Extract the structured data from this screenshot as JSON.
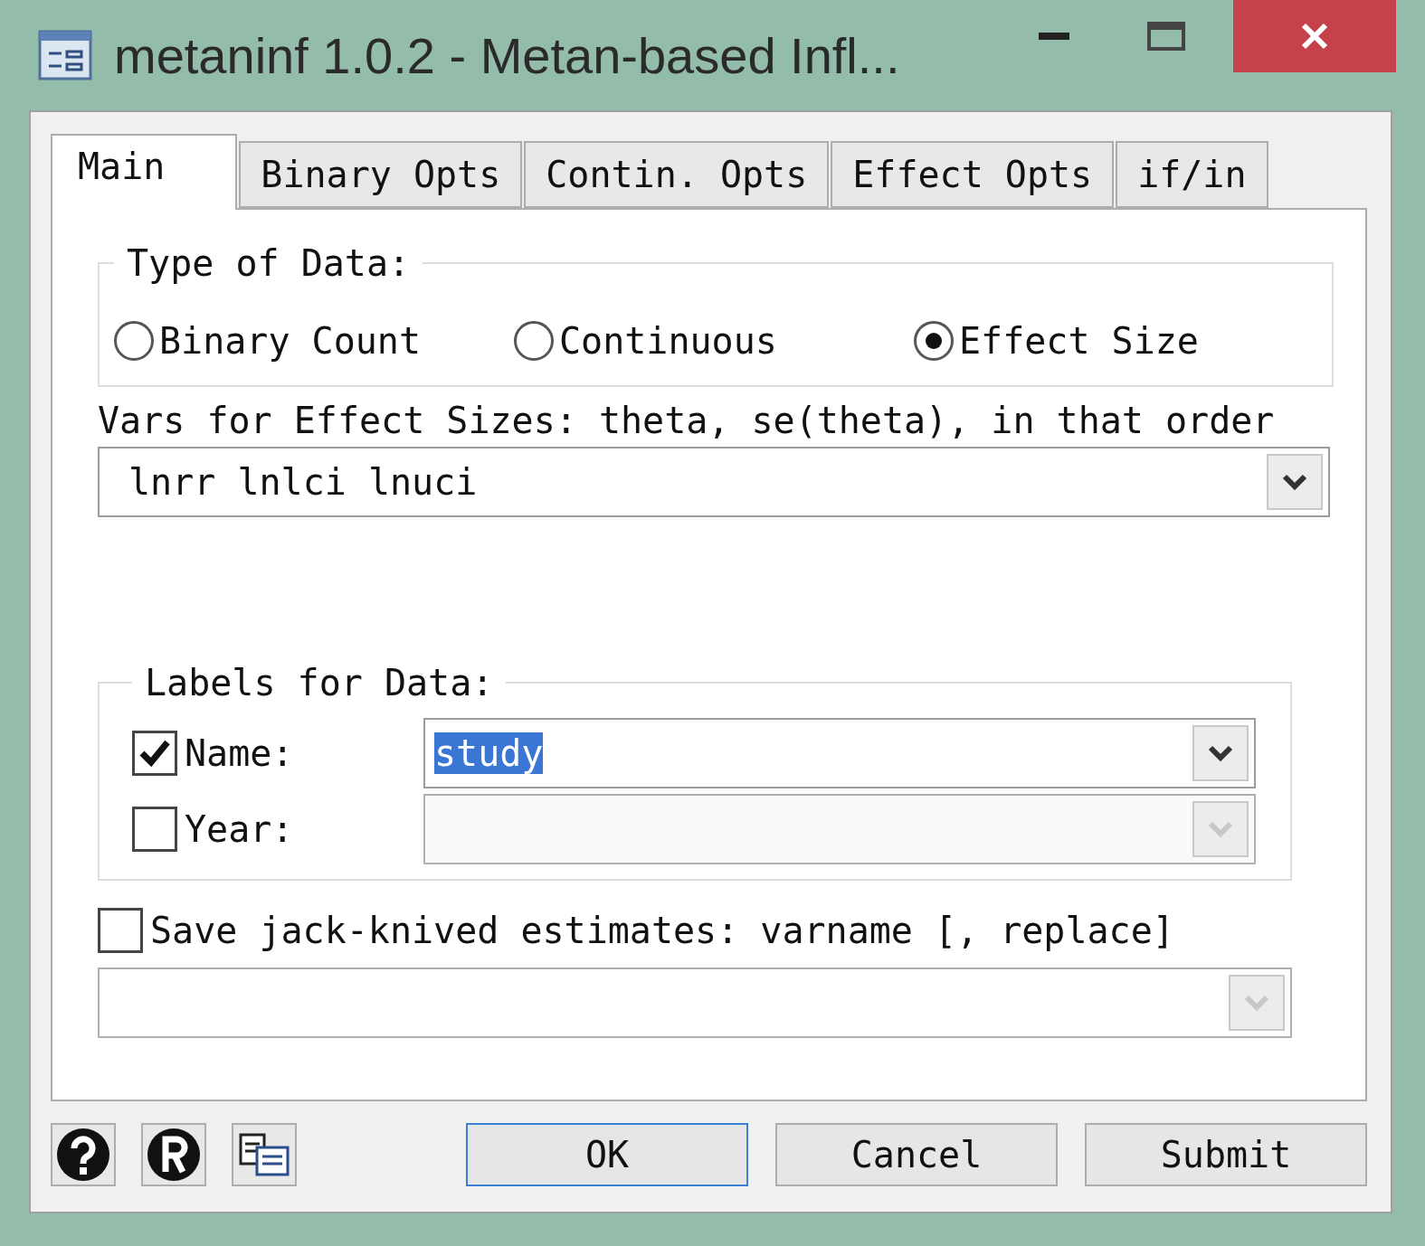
{
  "window": {
    "title": "metaninf 1.0.2 - Metan-based Infl..."
  },
  "tabs": [
    {
      "label": "Main",
      "selected": true
    },
    {
      "label": "Binary Opts",
      "selected": false
    },
    {
      "label": "Contin. Opts",
      "selected": false
    },
    {
      "label": "Effect Opts",
      "selected": false
    },
    {
      "label": "if/in",
      "selected": false
    }
  ],
  "type_of_data": {
    "legend": "Type of Data:",
    "options": [
      {
        "label": "Binary Count",
        "selected": false
      },
      {
        "label": "Continuous",
        "selected": false
      },
      {
        "label": "Effect Size",
        "selected": true
      }
    ]
  },
  "vars": {
    "label": "Vars for Effect Sizes: theta, se(theta), in that order",
    "value": "lnrr lnlci lnuci"
  },
  "labels_for_data": {
    "legend": "Labels for Data:",
    "rows": [
      {
        "label": "Name:",
        "checked": true,
        "value": "study",
        "disabled": false
      },
      {
        "label": "Year:",
        "checked": false,
        "disabled": true
      }
    ]
  },
  "save": {
    "label": "Save jack-knived estimates: varname [, replace]",
    "checked": false
  },
  "buttons": [
    {
      "label": "OK",
      "default": true
    },
    {
      "label": "Cancel",
      "default": false
    },
    {
      "label": "Submit",
      "default": false
    }
  ]
}
